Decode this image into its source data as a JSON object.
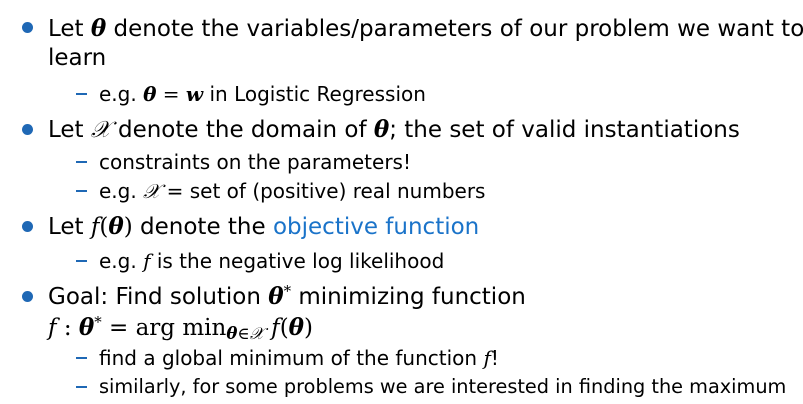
{
  "bullets": [
    {
      "line1_a": "Let ",
      "line1_sym": "θ",
      "line1_b": " denote the variables/parameters of our problem we want to",
      "line2": "learn",
      "subs": [
        {
          "a": "e.g. ",
          "sym1": "θ",
          "eq": " = ",
          "sym2": "w",
          "b": " in Logistic Regression"
        }
      ]
    },
    {
      "a": "Let ",
      "sym1": "𝒳",
      "b": " denote the domain of ",
      "sym2": "θ",
      "c": "; the set of valid instantiations",
      "subs": [
        {
          "text": "constraints on the parameters!"
        },
        {
          "a": "e.g. ",
          "sym": "𝒳",
          "b": " = set of (positive) real numbers"
        }
      ]
    },
    {
      "a": "Let ",
      "f": "f",
      "paren_open": "(",
      "sym": "θ",
      "paren_close": ")",
      "b": " denote the ",
      "highlight": "objective function",
      "subs": [
        {
          "a": "e.g. ",
          "f": "f",
          "b": " is the negative log likelihood"
        }
      ]
    },
    {
      "a": "Goal: Find solution ",
      "sym": "θ",
      "star": "*",
      "b": " minimizing function",
      "eq": {
        "f": "f",
        "colon": " : ",
        "theta": "θ",
        "star": "*",
        "equals": " = arg min",
        "sub_theta": "θ",
        "sub_in": "∈",
        "sub_X": "𝒳",
        "tail_f": " f",
        "tail_open": "(",
        "tail_theta": "θ",
        "tail_close": ")"
      },
      "subs": [
        {
          "a": "find a global minimum of the function ",
          "f": "f",
          "b": "!"
        },
        {
          "text": "similarly, for some problems we are interested in finding the maximum"
        }
      ]
    }
  ],
  "colors": {
    "bullet": "#1f68b5",
    "highlight": "#1a73c9"
  }
}
